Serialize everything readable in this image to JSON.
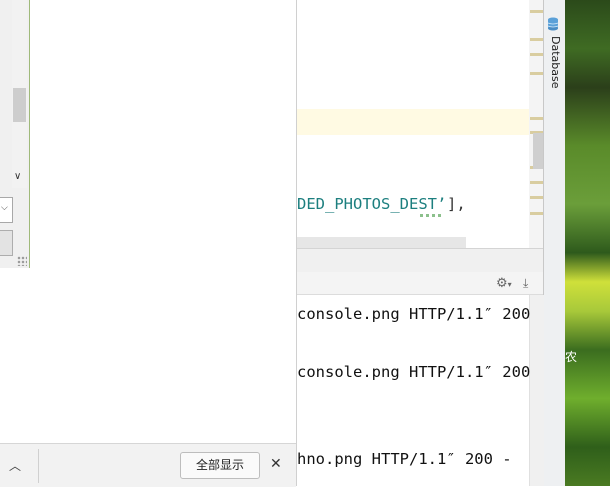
{
  "editor": {
    "code_fragment": "DED_PHOTOS_DEST’",
    "code_tail": "],"
  },
  "toolstrip": {
    "database_label": "Database"
  },
  "console": {
    "lines": [
      "console.png HTTP/1.1″ 200",
      "console.png HTTP/1.1″ 200",
      "hno.png HTTP/1.1″ 200 -"
    ]
  },
  "download_bar": {
    "show_all_label": "全部显示"
  },
  "wallpaper": {
    "fragment_char": "农"
  },
  "icons": {
    "gear": "⚙",
    "gear_caret": "▾",
    "download": "⤓",
    "up_chevron": "︿",
    "close": "✕",
    "chevron_down": "∨"
  }
}
